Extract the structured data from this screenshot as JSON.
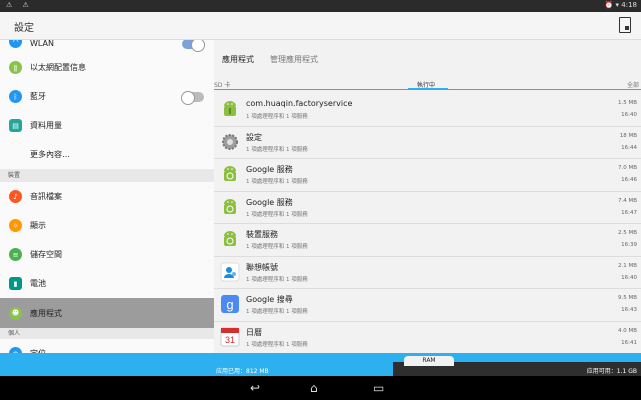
{
  "status": {
    "left": "⚠ ⚠",
    "right": "⏰ ▾ 4:18"
  },
  "appbar": {
    "title": "設定"
  },
  "settings": {
    "wlan": "WLAN",
    "ethernet": "以太網配置信息",
    "bluetooth": "藍牙",
    "data_usage": "資料用量",
    "more": "更多內容…",
    "section_device": "裝置",
    "sound": "音訊檔案",
    "display": "顯示",
    "storage": "儲存空間",
    "battery": "電池",
    "apps": "應用程式",
    "section_personal": "個人",
    "location": "定位"
  },
  "tabs": {
    "apps": "應用程式",
    "manage": "管理應用程式"
  },
  "filters": {
    "sd": "SD 卡",
    "running": "執行中",
    "all": "全部"
  },
  "apps": [
    {
      "name": "com.huaqin.factoryservice",
      "desc": "1 項處理程序和 1 項服務",
      "size": "1.5 MB",
      "time": "16:40"
    },
    {
      "name": "設定",
      "desc": "1 項處理程序和 1 項服務",
      "size": "18 MB",
      "time": "16:44"
    },
    {
      "name": "Google 服務",
      "desc": "1 項處理程序和 1 項服務",
      "size": "7.0 MB",
      "time": "16:46"
    },
    {
      "name": "Google 服務",
      "desc": "1 項處理程序和 1 項服務",
      "size": "7.4 MB",
      "time": "16:47"
    },
    {
      "name": "裝置服務",
      "desc": "1 項處理程序和 1 項服務",
      "size": "2.5 MB",
      "time": "16:39"
    },
    {
      "name": "聯想帳號",
      "desc": "1 項處理程序和 1 項服務",
      "size": "2.1 MB",
      "time": "16:40"
    },
    {
      "name": "Google 搜尋",
      "desc": "1 項處理程序和 1 項服務",
      "size": "9.5 MB",
      "time": "16:43"
    },
    {
      "name": "日曆",
      "desc": "1 項處理程序和 1 項服務",
      "size": "4.0 MB",
      "time": "16:41"
    }
  ],
  "ram": {
    "label": "RAM",
    "used": "应用已用：812 MB",
    "available": "应用可用：1.1 GB",
    "used_fraction": 0.42
  },
  "nav": {
    "back": "↩",
    "home": "⌂",
    "recent": "▭"
  },
  "colors": {
    "accent": "#2db0ef",
    "android_green": "#8cbf3f"
  }
}
